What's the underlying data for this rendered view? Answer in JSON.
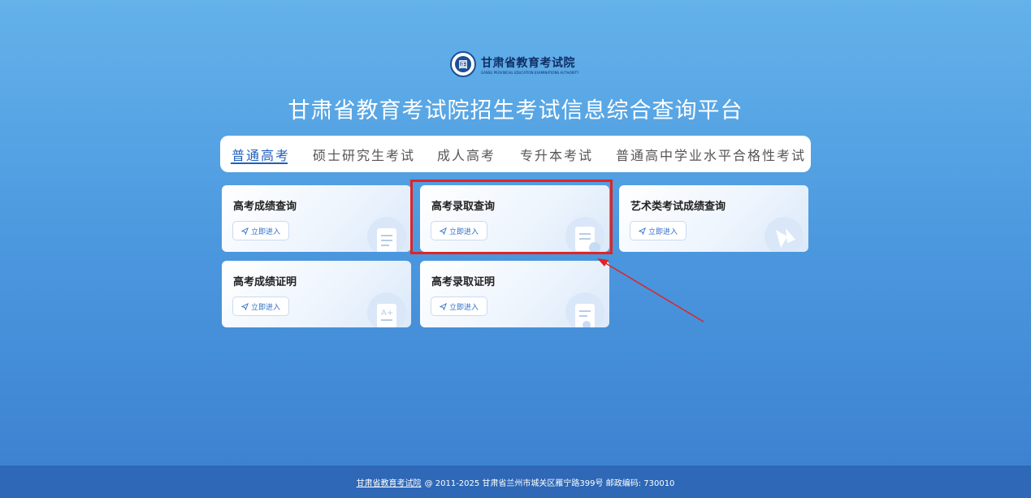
{
  "header": {
    "logo_cn": "甘肃省教育考试院",
    "logo_en": "GANSU PROVINCIAL EDUCATION EXAMINATIONS AUTHORITY",
    "logo_emblem_char": "囸",
    "title": "甘肃省教育考试院招生考试信息综合查询平台"
  },
  "tabs": [
    {
      "label": "普通高考",
      "active": true
    },
    {
      "label": "硕士研究生考试",
      "active": false
    },
    {
      "label": "成人高考",
      "active": false
    },
    {
      "label": "专升本考试",
      "active": false
    },
    {
      "label": "普通高中学业水平合格性考试",
      "active": false
    }
  ],
  "cards": [
    {
      "title": "高考成绩查询",
      "button": "立即进入",
      "icon": "document-icon"
    },
    {
      "title": "高考录取查询",
      "button": "立即进入",
      "icon": "admission-icon"
    },
    {
      "title": "艺术类考试成绩查询",
      "button": "立即进入",
      "icon": "art-icon"
    },
    {
      "title": "高考成绩证明",
      "button": "立即进入",
      "icon": "grade-certificate-icon"
    },
    {
      "title": "高考录取证明",
      "button": "立即进入",
      "icon": "admission-certificate-icon"
    }
  ],
  "footer": {
    "link": "甘肃省教育考试院",
    "text": "@ 2011-2025 甘肃省兰州市城关区雁宁路399号 邮政编码: 730010"
  },
  "colors": {
    "accent": "#1f5fbf",
    "highlight": "#e02424",
    "footer_bg": "#2e68b6"
  }
}
